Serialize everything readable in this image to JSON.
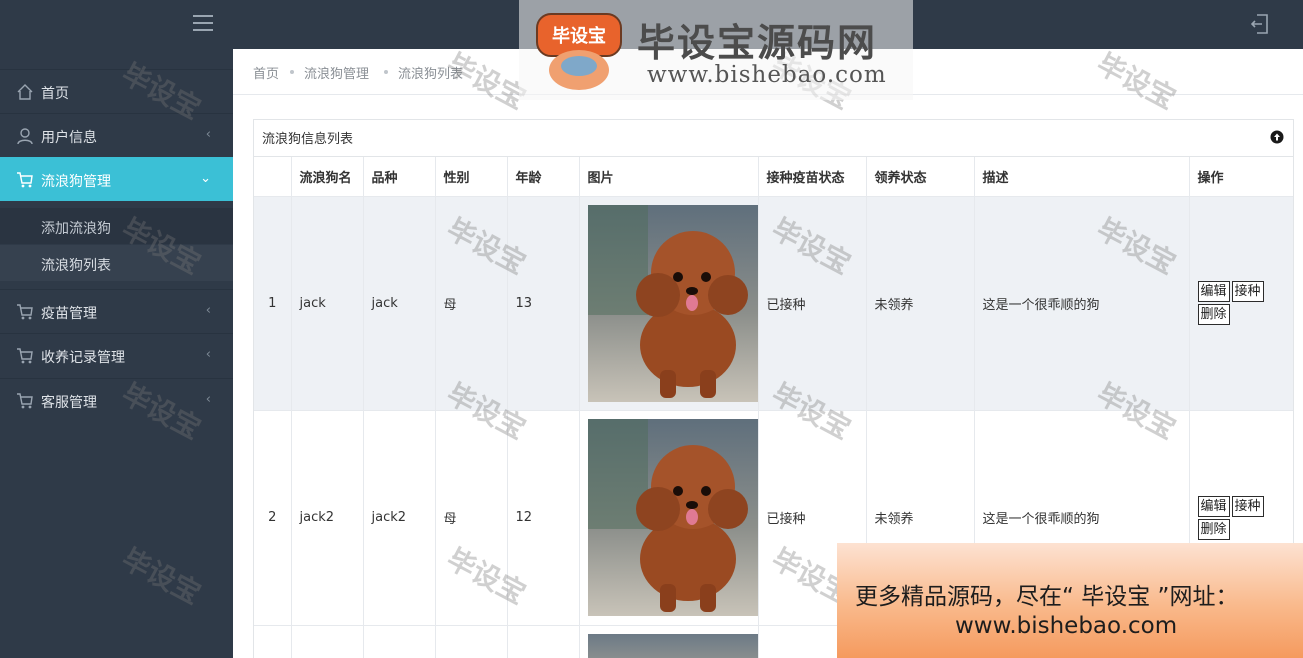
{
  "sidebar": {
    "items": [
      {
        "label": "首页",
        "icon": "home-icon"
      },
      {
        "label": "用户信息",
        "icon": "user-icon"
      },
      {
        "label": "流浪狗管理",
        "icon": "cart-icon",
        "active": true
      },
      {
        "label": "疫苗管理",
        "icon": "cart-icon"
      },
      {
        "label": "收养记录管理",
        "icon": "cart-icon"
      },
      {
        "label": "客服管理",
        "icon": "cart-icon"
      }
    ],
    "subitems": [
      {
        "label": "添加流浪狗"
      },
      {
        "label": "流浪狗列表"
      }
    ]
  },
  "breadcrumb": [
    "首页",
    "流浪狗管理",
    "流浪狗列表"
  ],
  "panel": {
    "title": "流浪狗信息列表"
  },
  "table": {
    "headers": [
      "",
      "流浪狗名",
      "品种",
      "性别",
      "年龄",
      "图片",
      "接种疫苗状态",
      "领养状态",
      "描述",
      "操作"
    ],
    "rows": [
      {
        "index": "1",
        "name": "jack",
        "breed": "jack",
        "sex": "母",
        "age": "13",
        "vaccine": "已接种",
        "adopt": "未领养",
        "desc": "这是一个很乖顺的狗"
      },
      {
        "index": "2",
        "name": "jack2",
        "breed": "jack2",
        "sex": "母",
        "age": "12",
        "vaccine": "已接种",
        "adopt": "未领养",
        "desc": "这是一个很乖顺的狗"
      }
    ],
    "actions": {
      "edit": "编辑",
      "vaccinate": "接种",
      "delete": "删除"
    }
  },
  "watermark": {
    "mark": "毕设宝",
    "title": "毕设宝源码网",
    "logo_text": "毕设宝",
    "url": "www.bishebao.com",
    "promo_line1": "更多精品源码，尽在“ 毕设宝 ”网址：",
    "promo_line2": "www.bishebao.com"
  },
  "colors": {
    "sidebar_bg": "#2f3a48",
    "active": "#3bc0d6",
    "row_alt": "#eef1f5"
  }
}
